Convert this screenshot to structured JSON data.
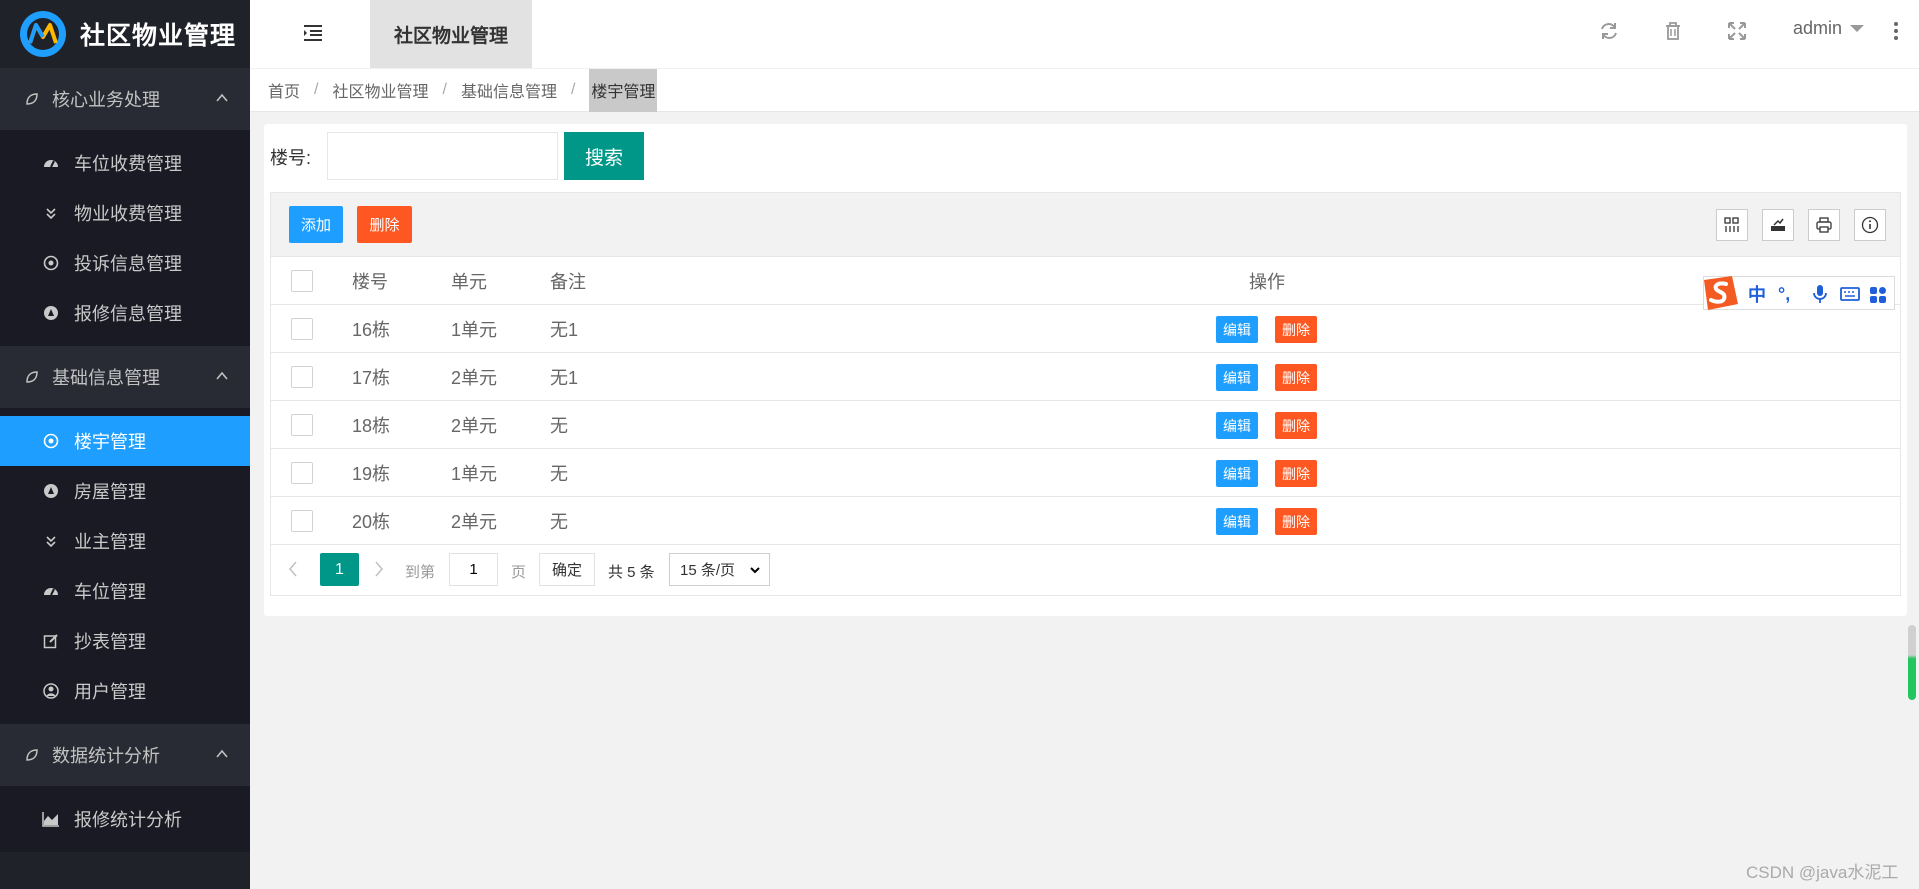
{
  "app": {
    "title": "社区物业管理",
    "logo_icon": "logo-m-icon",
    "colors": {
      "sidebar_bg": "#20222a",
      "active": "#1e9fff",
      "primary_green": "#009688",
      "danger": "#ff5722"
    }
  },
  "sidebar": {
    "groups": [
      {
        "label": "核心业务处理",
        "items": [
          {
            "label": "车位收费管理",
            "icon": "dashboard-icon"
          },
          {
            "label": "物业收费管理",
            "icon": "double-chevron-down-icon"
          },
          {
            "label": "投诉信息管理",
            "icon": "target-icon"
          },
          {
            "label": "报修信息管理",
            "icon": "compass-icon"
          }
        ]
      },
      {
        "label": "基础信息管理",
        "items": [
          {
            "label": "楼宇管理",
            "icon": "target-icon",
            "active": true
          },
          {
            "label": "房屋管理",
            "icon": "compass-icon"
          },
          {
            "label": "业主管理",
            "icon": "double-chevron-down-icon"
          },
          {
            "label": "车位管理",
            "icon": "dashboard-icon"
          },
          {
            "label": "抄表管理",
            "icon": "edit-icon"
          },
          {
            "label": "用户管理",
            "icon": "user-circle-icon"
          }
        ]
      },
      {
        "label": "数据统计分析",
        "items": [
          {
            "label": "报修统计分析",
            "icon": "area-chart-icon"
          }
        ]
      }
    ]
  },
  "header": {
    "active_tab": "社区物业管理",
    "user": "admin",
    "icons": [
      "refresh-icon",
      "trash-icon",
      "fullscreen-icon",
      "more-vertical-icon"
    ]
  },
  "breadcrumb": [
    "首页",
    "社区物业管理",
    "基础信息管理",
    "楼宇管理"
  ],
  "search": {
    "label": "楼号:",
    "value": "",
    "button": "搜索"
  },
  "toolbar": {
    "add": "添加",
    "delete": "删除",
    "tools": [
      "columns-icon",
      "export-icon",
      "print-icon",
      "info-icon"
    ]
  },
  "table": {
    "columns": [
      "楼号",
      "单元",
      "备注",
      "操作"
    ],
    "rows": [
      {
        "building": "16栋",
        "unit": "1单元",
        "note": "无1"
      },
      {
        "building": "17栋",
        "unit": "2单元",
        "note": "无1"
      },
      {
        "building": "18栋",
        "unit": "2单元",
        "note": "无"
      },
      {
        "building": "19栋",
        "unit": "1单元",
        "note": "无"
      },
      {
        "building": "20栋",
        "unit": "2单元",
        "note": "无"
      }
    ],
    "row_actions": {
      "edit": "编辑",
      "delete": "删除"
    }
  },
  "pager": {
    "current": "1",
    "goto_prefix": "到第",
    "goto_value": "1",
    "goto_suffix": "页",
    "confirm": "确定",
    "total": "共 5 条",
    "page_size": "15 条/页"
  },
  "ime": {
    "items": [
      "中",
      "°,"
    ]
  },
  "watermark": "CSDN @java水泥工"
}
